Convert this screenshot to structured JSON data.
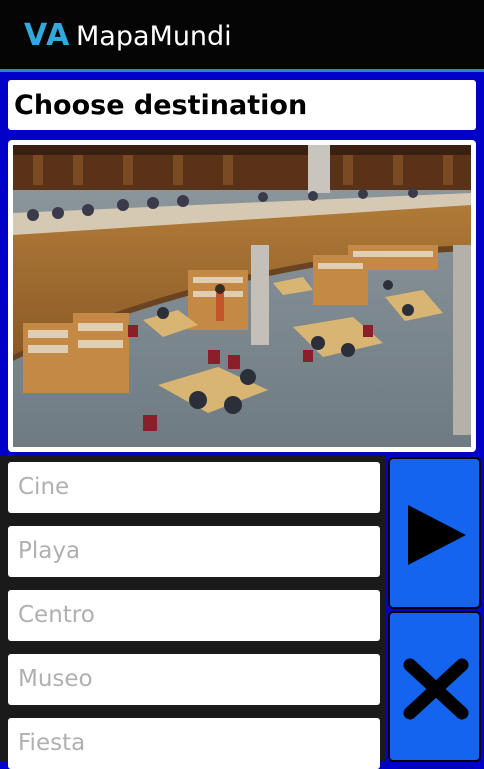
{
  "app": {
    "logo": "VA",
    "title": "MapaMundi"
  },
  "destination": {
    "title": "Choose destination"
  },
  "options": [
    {
      "placeholder": "Cine"
    },
    {
      "placeholder": "Playa"
    },
    {
      "placeholder": "Centro"
    },
    {
      "placeholder": "Museo"
    },
    {
      "placeholder": "Fiesta"
    }
  ],
  "buttons": {
    "play_icon": "play-icon",
    "close_icon": "close-icon"
  },
  "colors": {
    "background": "#0000c8",
    "actionbar": "#050505",
    "accent": "#33a8dc",
    "button": "#1464f0"
  }
}
